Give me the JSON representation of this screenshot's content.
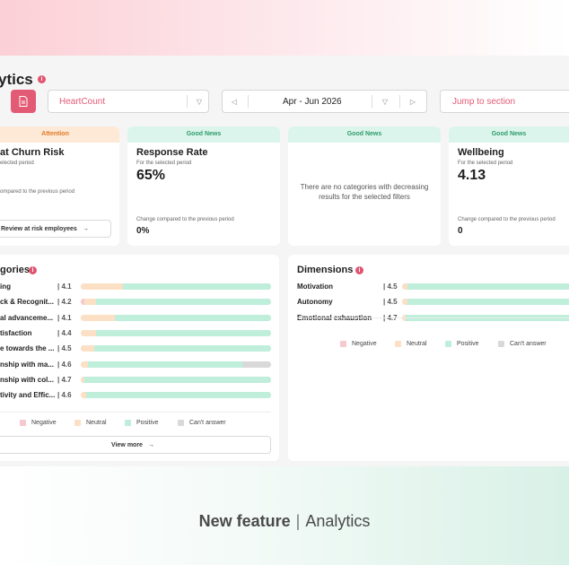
{
  "page": {
    "title": "ytics"
  },
  "toolbar": {
    "survey_select": "HeartCount",
    "period": "Apr - Jun 2026",
    "jump": "Jump to section"
  },
  "cards": {
    "churn": {
      "badge": "Attention",
      "title": "at Churn Risk",
      "subtitle": "elected period",
      "change_label": "ompared to the previous period",
      "button": "Review at risk employees"
    },
    "response": {
      "badge": "Good News",
      "title": "Response Rate",
      "subtitle": "For the selected period",
      "value": "65%",
      "change_label": "Change compared to the previous period",
      "change_value": "0%"
    },
    "categories_news": {
      "badge": "Good News",
      "message": "There are no categories with decreasing results for the selected filters"
    },
    "wellbeing": {
      "badge": "Good News",
      "title": "Wellbeing",
      "subtitle": "For the selected period",
      "value": "4.13",
      "change_label": "Change compared to the previous period",
      "change_value": "0"
    }
  },
  "categories": {
    "title": "gories",
    "rows": [
      {
        "label": "ing",
        "score": "4.1",
        "neg": 0.0,
        "neu": 0.22,
        "pos": 0.78,
        "ca": 0.0
      },
      {
        "label": "ck & Recognit...",
        "score": "4.2",
        "neg": 0.02,
        "neu": 0.06,
        "pos": 0.92,
        "ca": 0.0
      },
      {
        "label": "al advanceme...",
        "score": "4.1",
        "neg": 0.0,
        "neu": 0.18,
        "pos": 0.82,
        "ca": 0.0
      },
      {
        "label": "tisfaction",
        "score": "4.4",
        "neg": 0.0,
        "neu": 0.08,
        "pos": 0.92,
        "ca": 0.0
      },
      {
        "label": "e towards the ...",
        "score": "4.5",
        "neg": 0.0,
        "neu": 0.07,
        "pos": 0.93,
        "ca": 0.0
      },
      {
        "label": "nship with ma...",
        "score": "4.6",
        "neg": 0.0,
        "neu": 0.04,
        "pos": 0.81,
        "ca": 0.15
      },
      {
        "label": "nship with col...",
        "score": "4.7",
        "neg": 0.0,
        "neu": 0.02,
        "pos": 0.98,
        "ca": 0.0
      },
      {
        "label": "tivity and Effic...",
        "score": "4.6",
        "neg": 0.0,
        "neu": 0.03,
        "pos": 0.97,
        "ca": 0.0
      }
    ],
    "view_more": "View more"
  },
  "dimensions": {
    "title": "Dimensions",
    "rows": [
      {
        "label": "Motivation",
        "score": "4.5",
        "neg": 0.0,
        "neu": 0.03,
        "pos": 0.97,
        "ca": 0.0
      },
      {
        "label": "Autonomy",
        "score": "4.5",
        "neg": 0.0,
        "neu": 0.03,
        "pos": 0.97,
        "ca": 0.0
      },
      {
        "label": "Emotional exhaustion",
        "score": "4.7",
        "neg": 0.0,
        "neu": 0.02,
        "pos": 0.98,
        "ca": 0.0
      }
    ]
  },
  "legend": {
    "negative": "Negative",
    "neutral": "Neutral",
    "positive": "Positive",
    "cant_answer": "Can't answer"
  },
  "colors": {
    "negative": "#f6c9cf",
    "neutral": "#fbe0c6",
    "positive": "#bfeedb",
    "cant_answer": "#d9d9d9",
    "accent": "#e35a75"
  },
  "footer": {
    "strong": "New feature",
    "separator": "|",
    "light": "Analytics"
  }
}
